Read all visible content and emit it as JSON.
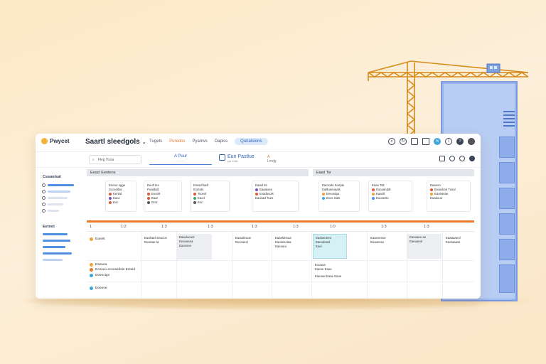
{
  "colors": {
    "accent": "#ec7a2a",
    "brand_blue": "#2f62b5",
    "highlight": "#d6f1f5"
  },
  "app": {
    "logo": "Pwycet",
    "title": "Saartl sleedgols",
    "title_chevron": "chevron-down-icon"
  },
  "nav": {
    "tabs": [
      "Tugets",
      "Puredos",
      "Pyamvs",
      "Dapiss",
      "Qunatsions"
    ],
    "active_index": 1,
    "pill_index": 4
  },
  "top_icons": [
    "search-icon",
    "refresh-icon",
    "bell-icon",
    "document-icon",
    "s-icon",
    "info-icon",
    "help-icon",
    "user-avatar"
  ],
  "toolbar": {
    "search_placeholder": "Fleg Vsoa",
    "date_label": "A Puur",
    "date_sub": "-- -- ----",
    "panel_label": "Eun Pastlue",
    "panel_sub": "yar   Exlb",
    "badge_label": "A",
    "badge_sub": "Lmdg",
    "right_icons": [
      "grid-icon",
      "clock-icon",
      "chat-icon",
      "settings-icon"
    ]
  },
  "sidebar": {
    "section1": "Cssaolsal",
    "section2": "Eetnol",
    "items": [
      {
        "icon": "list-icon",
        "progress": 0.92
      },
      {
        "icon": "tag-icon",
        "progress": 0.8
      },
      {
        "icon": "folder-icon",
        "progress": 0.7
      },
      {
        "icon": "link-icon",
        "progress": 0.55
      },
      {
        "icon": "cloud-icon",
        "progress": 0.4
      }
    ],
    "items2": [
      0.75,
      0.85,
      0.7,
      0.9,
      0.6
    ]
  },
  "board": {
    "section_left": "Eeacl Eeotens",
    "section_right": "Eiaol Tsr",
    "cards": [
      {
        "lines": [
          "Eneoo ogge",
          "Scceditas",
          "Eenkd",
          "Eaoc",
          "Eoc"
        ]
      },
      {
        "lines": [
          "Eeotl tes",
          "Poaldsdi",
          "Eeonlt",
          "Eaal",
          "Dcsl"
        ]
      },
      {
        "lines": [
          "Esssdl tadl",
          "Ecetols",
          "Tsoesl",
          "Eacd",
          "Eoc"
        ]
      },
      {
        "lines": [
          "Eaaol tts",
          "Eaaaioes",
          "Exadosols",
          "Eaunad Tues"
        ]
      },
      {
        "lines": [
          "Eacsoitu Sonple",
          "Eatlloeeoaals",
          "Eeeoslqa",
          "Exos Sals"
        ]
      },
      {
        "lines": [
          "Eaao Tslt",
          "Eocaanddt",
          "Eaanlt",
          "Eooseslo"
        ]
      },
      {
        "lines": [
          "Eaaeoo",
          "Eeaedool Tusol",
          "Eaoleetae",
          "Euadouo"
        ]
      }
    ],
    "ticks": [
      "1",
      "1:2",
      "1:3",
      "1:3",
      "1:3",
      "1:3",
      "1:0",
      "1:3",
      "1:3"
    ],
    "rows": [
      "Eanelt",
      "Eseuea",
      "Ecsoeo ecsosedsie Ecteid",
      "Eeeoctgo",
      "Eeeooe"
    ],
    "cells": [
      {
        "lines": [
          "Eaulsacl Eaucos",
          "Eeaisae ta"
        ]
      },
      {
        "lines": [
          "Eaaolueonl",
          "Eeaoasea",
          "Eaosnoe"
        ]
      },
      {
        "lines": [
          "Eaaudeuue",
          "Eeceaesl"
        ]
      },
      {
        "lines": [
          "Eaaeldesua",
          "Eaosesolaa",
          "Eaeoaoi"
        ]
      },
      {
        "lines": [
          "Eadoeueeo",
          "Eaeodosol",
          "Euel"
        ]
      },
      {
        "lines": [
          "Eaueoesoe",
          "Eeaoesee"
        ]
      },
      {
        "lines": [
          "Eaooaee ae",
          "Eaeuaeol"
        ]
      },
      {
        "lines": [
          "Eaaaaaeol",
          "Eeetaaass"
        ]
      }
    ],
    "lower_cells": [
      {
        "lines": [
          "Eooaoa",
          "Eaeoe Eaoe"
        ]
      },
      {
        "lines": [
          "Eaeoae Eaae Eaoe"
        ]
      }
    ]
  }
}
